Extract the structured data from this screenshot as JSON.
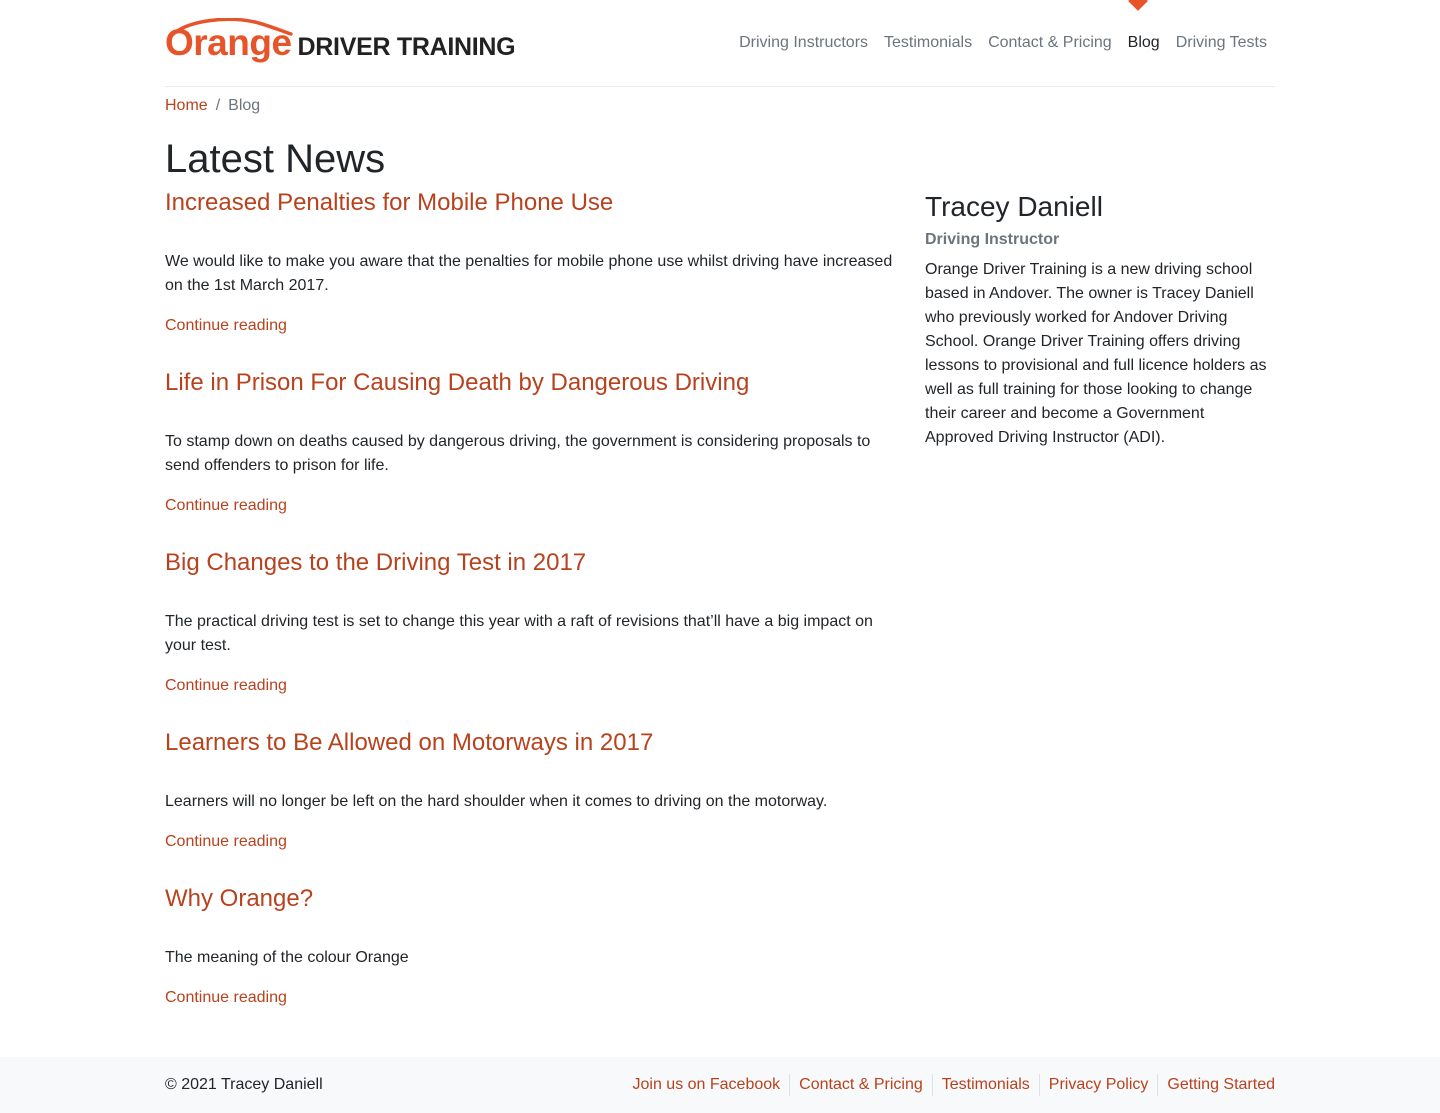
{
  "brand": {
    "logo_word": "Orange",
    "logo_tagline": "DRIVER TRAINING",
    "accent_color": "#e8542a",
    "link_color": "#b8421e"
  },
  "nav": {
    "items": [
      {
        "label": "Driving Instructors",
        "active": false
      },
      {
        "label": "Testimonials",
        "active": false
      },
      {
        "label": "Contact & Pricing",
        "active": false
      },
      {
        "label": "Blog",
        "active": true
      },
      {
        "label": "Driving Tests",
        "active": false
      }
    ]
  },
  "breadcrumb": {
    "home": "Home",
    "separator": "/",
    "current": "Blog"
  },
  "page": {
    "title": "Latest News"
  },
  "posts": [
    {
      "title": "Increased Penalties for Mobile Phone Use",
      "excerpt": "We would like to make you aware that the penalties for mobile phone use whilst driving have increased on the 1st March 2017.",
      "more": "Continue reading"
    },
    {
      "title": "Life in Prison For Causing Death by Dangerous Driving",
      "excerpt": "To stamp down on deaths caused by dangerous driving, the government is considering proposals to send offenders to prison for life.",
      "more": "Continue reading"
    },
    {
      "title": "Big Changes to the Driving Test in 2017",
      "excerpt": "The practical driving test is set to change this year with a raft of revisions that’ll have a big impact on your test.",
      "more": "Continue reading"
    },
    {
      "title": "Learners to Be Allowed on Motorways in 2017",
      "excerpt": "Learners will no longer be left on the hard shoulder when it comes to driving on the motorway.",
      "more": "Continue reading"
    },
    {
      "title": "Why Orange?",
      "excerpt": "The meaning of the colour Orange",
      "more": "Continue reading"
    }
  ],
  "sidebar": {
    "name": "Tracey Daniell",
    "role": "Driving Instructor",
    "bio": "Orange Driver Training is a new driving school based in Andover. The owner is Tracey Daniell who previously worked for Andover Driving School. Orange Driver Training offers driving lessons to provisional and full licence holders as well as full training for those looking to change their career and become a Government Approved Driving Instructor (ADI)."
  },
  "footer": {
    "copyright": "© 2021  Tracey Daniell",
    "links": [
      "Join us on Facebook",
      "Contact & Pricing",
      "Testimonials",
      "Privacy Policy",
      "Getting Started"
    ]
  }
}
